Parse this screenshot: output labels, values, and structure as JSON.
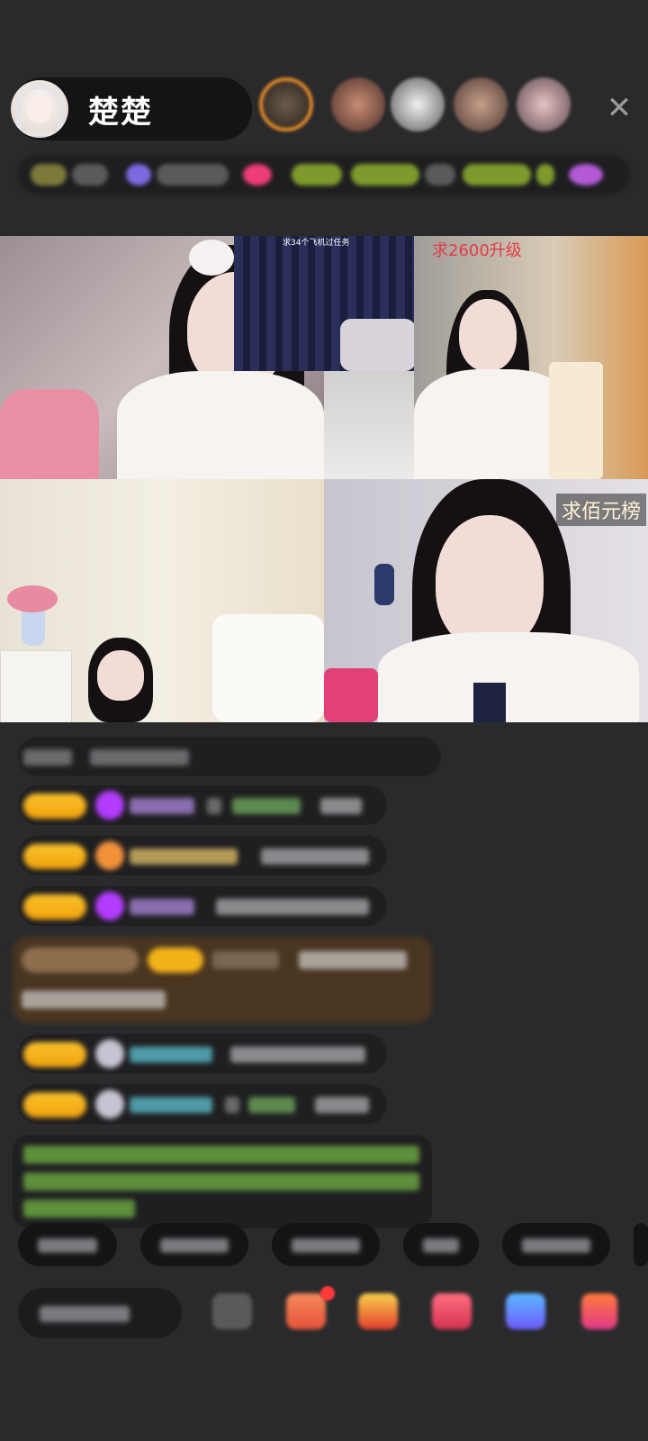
{
  "header": {
    "host_name": "楚楚",
    "close_icon": "close-icon"
  },
  "video_grid": {
    "tiles": [
      {
        "id": "top-left"
      },
      {
        "id": "top-middle-inset",
        "label": "求34个飞机过任务"
      },
      {
        "id": "top-right",
        "label": "求2600升级"
      },
      {
        "id": "bottom-left"
      },
      {
        "id": "bottom-right",
        "label": "求佰元榜"
      }
    ]
  },
  "colors": {
    "background": "#2a2a2c",
    "pill": "#141416",
    "level_badge": "#f2a20d",
    "green_message": "#6fbf3f",
    "label_red": "#e23a4a",
    "label_cream": "#fff3d6"
  },
  "bottom_bar": {
    "icons": [
      "gift-box-icon",
      "treasure-icon",
      "heart-gift-icon",
      "game-icon",
      "more-gifts-icon"
    ]
  }
}
